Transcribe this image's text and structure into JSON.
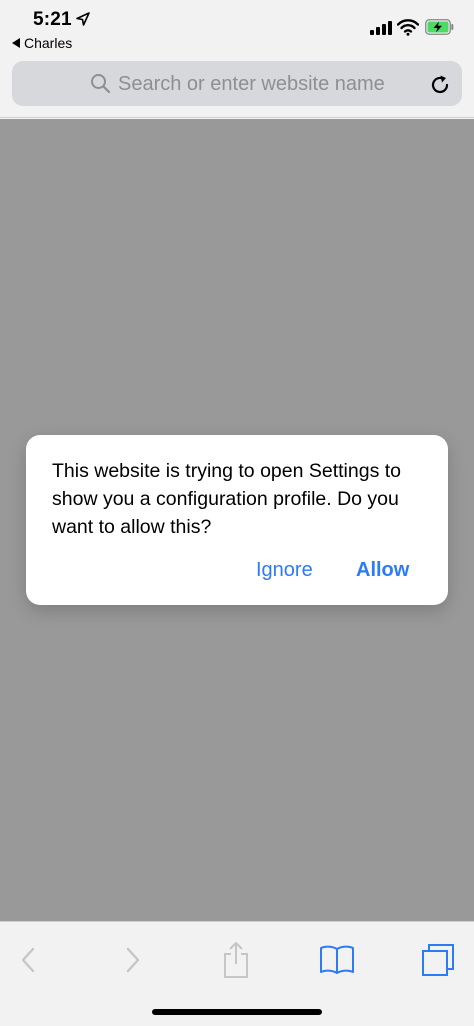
{
  "status_bar": {
    "time": "5:21",
    "back_app": "Charles",
    "icons": [
      "location-arrow-icon",
      "signal-icon",
      "wifi-icon",
      "battery-charging-icon"
    ]
  },
  "address_bar": {
    "placeholder": "Search or enter website name",
    "icons": [
      "search-icon",
      "reload-icon"
    ]
  },
  "alert": {
    "message": "This website is trying to open Settings to show you a configuration profile. Do you want to allow this?",
    "ignore_label": "Ignore",
    "allow_label": "Allow"
  },
  "toolbar": {
    "items": [
      "back-icon",
      "forward-icon",
      "share-icon",
      "bookmarks-icon",
      "tabs-icon"
    ]
  },
  "colors": {
    "accent": "#2c7cf6",
    "dim_overlay": "#999999",
    "chrome": "#f2f2f3",
    "disabled_icon": "#c6c6c8",
    "battery_green": "#4cd964"
  }
}
